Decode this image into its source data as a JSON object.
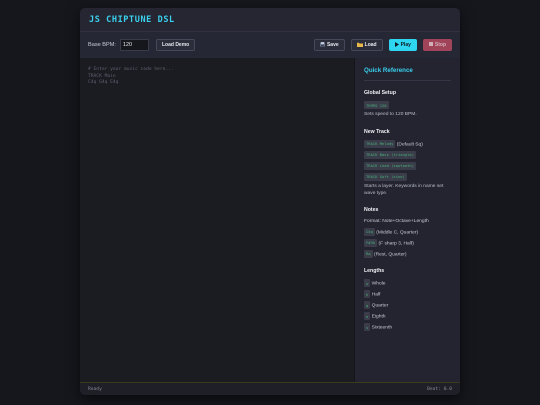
{
  "app": {
    "title": "JS CHIPTUNE DSL"
  },
  "toolbar": {
    "bpm_label": "Base BPM:",
    "bpm_value": "120",
    "load_demo": "Load Demo",
    "save": "Save",
    "save_icon": "floppy-disk-icon",
    "load": "Load",
    "load_icon": "folder-icon",
    "play": "Play",
    "play_icon": "play-icon",
    "stop": "Stop",
    "stop_icon": "stop-square-icon",
    "colors": {
      "play": "#2fd6f0",
      "stop": "#b84a60",
      "accent": "#3ad0ee"
    }
  },
  "editor": {
    "lines": [
      "# Enter your music code here...",
      "TRACK Main",
      "C4q G4q E4q"
    ]
  },
  "reference": {
    "title": "Quick Reference",
    "global": {
      "title": "Global Setup",
      "code": "TEMPO 120",
      "desc": "Sets speed to 120 BPM."
    },
    "track": {
      "title": "New Track",
      "codes": [
        {
          "code": "TRACK Melody",
          "note": "(Default Sq)"
        },
        {
          "code": "TRACK Bass (triangle)",
          "note": ""
        },
        {
          "code": "TRACK Lead (sawtooth)",
          "note": ""
        },
        {
          "code": "TRACK Soft (sine)",
          "note": ""
        }
      ],
      "desc": "Starts a layer. Keywords in name set wave type."
    },
    "notes": {
      "title": "Notes",
      "format": "Format: Note+Octave+Length",
      "items": [
        {
          "code": "C4q",
          "desc": "(Middle C, Quarter)"
        },
        {
          "code": "F#3h",
          "desc": "(F sharp 3, Half)"
        },
        {
          "code": "Rq",
          "desc": "(Rest, Quarter)"
        }
      ]
    },
    "lengths": {
      "title": "Lengths",
      "items": [
        {
          "code": "w",
          "desc": "Whole"
        },
        {
          "code": "h",
          "desc": "Half"
        },
        {
          "code": "q",
          "desc": "Quarter"
        },
        {
          "code": "e",
          "desc": "Eighth"
        },
        {
          "code": "s",
          "desc": "Sixteenth"
        }
      ]
    }
  },
  "status": {
    "left": "Ready",
    "right": "Beat: 0.0"
  }
}
